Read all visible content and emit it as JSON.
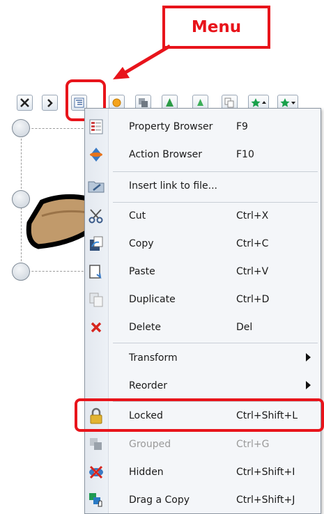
{
  "callout": {
    "label": "Menu"
  },
  "toolbar": {
    "buttons": [
      {
        "name": "fit-icon"
      },
      {
        "name": "arrow-icon"
      },
      {
        "name": "menu-icon"
      },
      {
        "name": "sun-icon"
      },
      {
        "name": "layer-icon"
      },
      {
        "name": "tree-icon"
      },
      {
        "name": "tree-alt-icon"
      },
      {
        "name": "copy-icon"
      },
      {
        "name": "star-up-icon"
      },
      {
        "name": "star-down-icon"
      }
    ]
  },
  "menu": {
    "items": [
      {
        "id": "property-browser",
        "label": "Property Browser",
        "shortcut": "F9",
        "icon": "property-browser-icon"
      },
      {
        "id": "action-browser",
        "label": "Action Browser",
        "shortcut": "F10",
        "icon": "action-browser-icon"
      },
      {
        "id": "insert-link",
        "label": "Insert link to file...",
        "shortcut": "",
        "icon": "folder-link-icon"
      },
      {
        "id": "cut",
        "label": "Cut",
        "shortcut": "Ctrl+X",
        "icon": "scissors-icon"
      },
      {
        "id": "copy",
        "label": "Copy",
        "shortcut": "Ctrl+C",
        "icon": "copy-icon"
      },
      {
        "id": "paste",
        "label": "Paste",
        "shortcut": "Ctrl+V",
        "icon": "paste-icon"
      },
      {
        "id": "duplicate",
        "label": "Duplicate",
        "shortcut": "Ctrl+D",
        "icon": "duplicate-icon"
      },
      {
        "id": "delete",
        "label": "Delete",
        "shortcut": "Del",
        "icon": "delete-x-icon"
      },
      {
        "id": "transform",
        "label": "Transform",
        "shortcut": "",
        "icon": ""
      },
      {
        "id": "reorder",
        "label": "Reorder",
        "shortcut": "",
        "icon": ""
      },
      {
        "id": "locked",
        "label": "Locked",
        "shortcut": "Ctrl+Shift+L",
        "icon": "padlock-icon"
      },
      {
        "id": "grouped",
        "label": "Grouped",
        "shortcut": "Ctrl+G",
        "icon": "group-icon"
      },
      {
        "id": "hidden",
        "label": "Hidden",
        "shortcut": "Ctrl+Shift+I",
        "icon": "hidden-eye-icon"
      },
      {
        "id": "drag-copy",
        "label": "Drag a Copy",
        "shortcut": "Ctrl+Shift+J",
        "icon": "drag-copy-icon"
      }
    ]
  },
  "colors": {
    "highlight": "#e8141b",
    "menu_bg": "#f4f6f9",
    "disabled_text": "#9a9a9a"
  }
}
